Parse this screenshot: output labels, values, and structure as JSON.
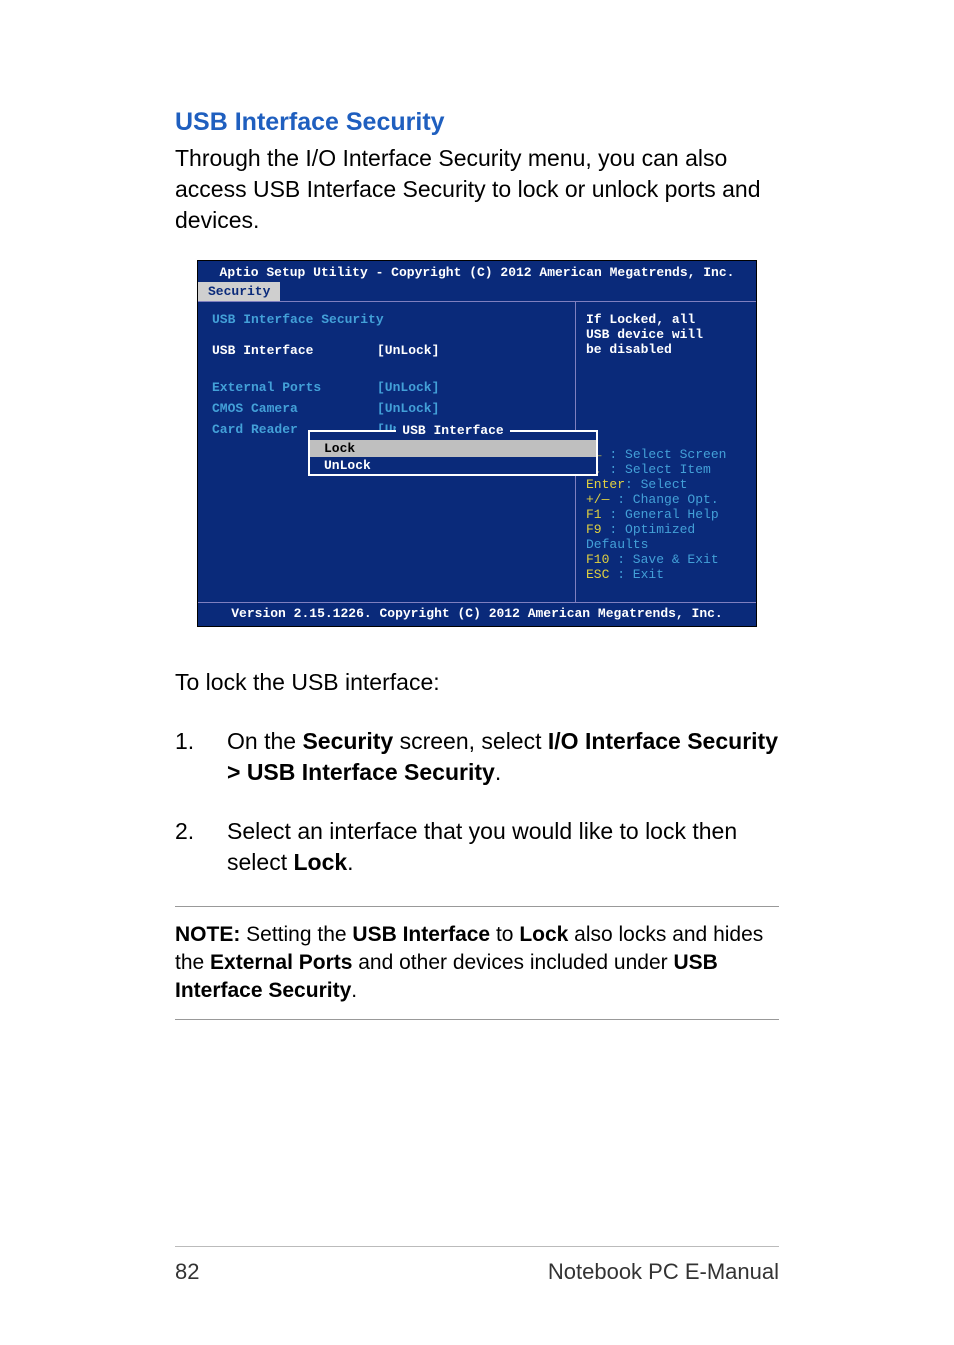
{
  "section_heading": "USB Interface Security",
  "intro_para": "Through the I/O Interface Security menu, you can also access USB Interface Security to lock or unlock ports and devices.",
  "bios": {
    "title": "Aptio Setup Utility - Copyright (C) 2012 American Megatrends, Inc.",
    "tab_active": "Security",
    "main_heading": "USB Interface Security",
    "rows": {
      "usb_interface": {
        "label": "USB Interface",
        "value": "[UnLock]"
      },
      "external_ports": {
        "label": "External Ports",
        "value": "[UnLock]"
      },
      "cmos_camera": {
        "label": "CMOS Camera",
        "value": "[UnLock]"
      },
      "card_reader": {
        "label": "Card Reader",
        "value": "[UnLock]"
      }
    },
    "popup": {
      "title": "USB Interface",
      "opt1": "Lock",
      "opt2": "UnLock"
    },
    "help": {
      "desc1": "If Locked, all",
      "desc2": "USB device will",
      "desc3": "be disabled",
      "nav1_key": "→←",
      "nav1": " : Select Screen",
      "nav2_key": "↑↓",
      "nav2": " : Select Item",
      "nav3_key": "Enter",
      "nav3": ": Select",
      "nav4_key": "+/—",
      "nav4": "  : Change Opt.",
      "nav5_key": "F1",
      "nav5": "   : General Help",
      "nav6_key": "F9",
      "nav6": "   : Optimized",
      "nav6b": "Defaults",
      "nav7_key": "F10",
      "nav7": "  : Save & Exit",
      "nav8_key": "ESC",
      "nav8": "  : Exit"
    },
    "footer": "Version 2.15.1226. Copyright (C) 2012 American Megatrends, Inc."
  },
  "lock_intro": "To lock the USB interface:",
  "steps": {
    "s1a": "On the ",
    "s1b": "Security",
    "s1c": " screen, select ",
    "s1d": "I/O Interface Security > USB Interface Security",
    "s1e": ".",
    "s2a": "Select an interface that you would like to lock then select ",
    "s2b": "Lock",
    "s2c": "."
  },
  "note": {
    "n1": "NOTE:",
    "n2": " Setting the ",
    "n3": "USB Interface",
    "n4": " to ",
    "n5": "Lock",
    "n6": " also locks and hides the ",
    "n7": "External Ports",
    "n8": " and other devices included under ",
    "n9": "USB Interface Security",
    "n10": "."
  },
  "footer": {
    "page_no": "82",
    "doc_title": "Notebook PC E-Manual"
  }
}
